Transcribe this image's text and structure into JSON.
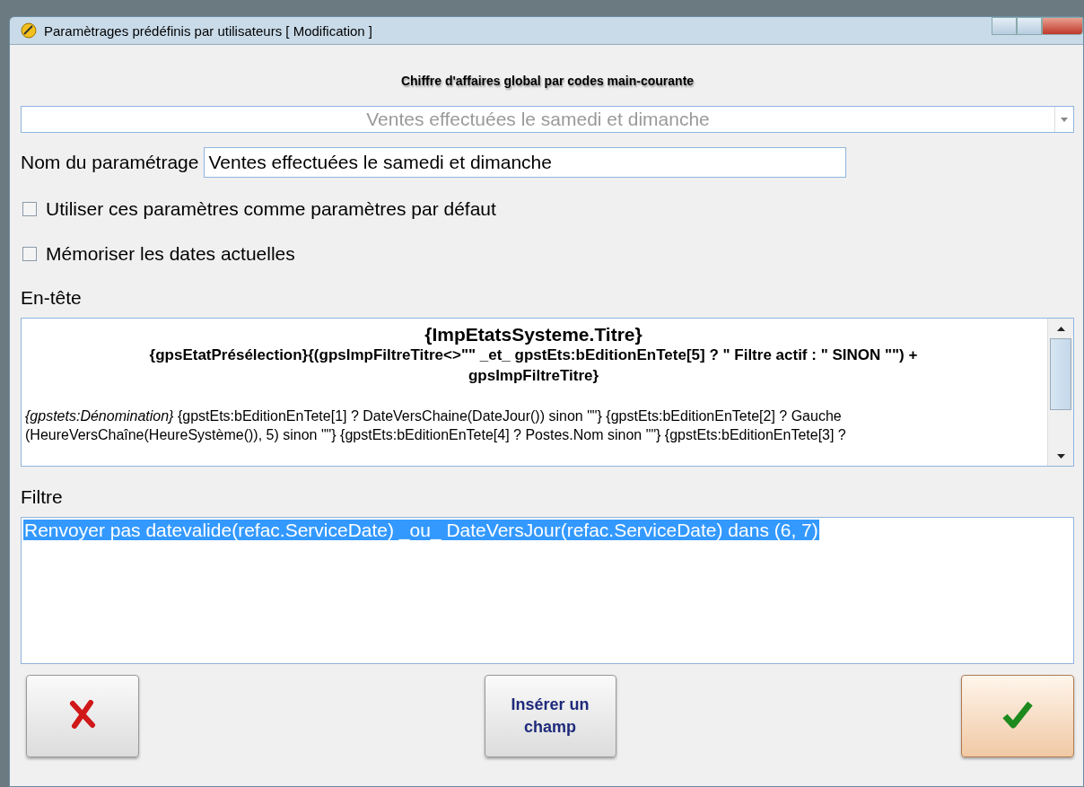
{
  "window": {
    "title": "Paramètrages prédéfinis par utilisateurs  [ Modification ]"
  },
  "report_title": "Chiffre d'affaires global par codes main-courante",
  "preset_dropdown": {
    "value": "Ventes effectuées le samedi et dimanche"
  },
  "name_field": {
    "label": "Nom du paramétrage",
    "value": "Ventes effectuées le samedi et dimanche"
  },
  "checkboxes": [
    {
      "label": "Utiliser ces paramètres comme paramètres par défaut",
      "checked": false
    },
    {
      "label": "Mémoriser les dates actuelles",
      "checked": false
    }
  ],
  "header": {
    "label": "En-tête",
    "lines": [
      {
        "kind": "title",
        "text": "{ImpEtatsSysteme.Titre}"
      },
      {
        "kind": "subtitle",
        "text": "{gpsEtatPrésélection}{(gpsImpFiltreTitre<>\"\" _et_ gpstEts:bEditionEnTete[5]  ? \" Filtre actif : \" SINON \"\") + gpsImpFiltreTitre}"
      },
      {
        "kind": "body",
        "text": "*{gpstets:Dénomination}* {gpstEts:bEditionEnTete[1] ? DateVersChaine(DateJour()) sinon \"\"} {gpstEts:bEditionEnTete[2] ? Gauche (HeureVersChaîne(HeureSystème()), 5) sinon \"\"} {gpstEts:bEditionEnTete[4] ? Postes.Nom sinon \"\"} {gpstEts:bEditionEnTete[3] ?"
      }
    ]
  },
  "filter": {
    "label": "Filtre",
    "text": "Renvoyer pas datevalide(refac.ServiceDate) _ou_ DateVersJour(refac.ServiceDate) dans (6, 7)",
    "selected": true
  },
  "buttons": [
    {
      "kind": "cancel",
      "default": false
    },
    {
      "kind": "insert",
      "label": "Insérer un champ",
      "default": false
    },
    {
      "kind": "ok",
      "default": true
    }
  ]
}
